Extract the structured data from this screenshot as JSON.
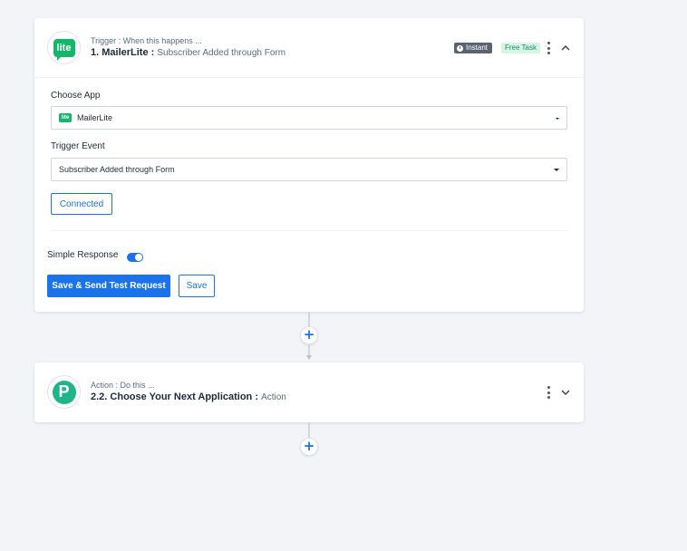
{
  "trigger": {
    "subtitle": "Trigger : When this happens ...",
    "title_strong": "1. MailerLite :",
    "title_light": "Subscriber Added through Form",
    "logo_text": "lite",
    "badge_instant": "Instant",
    "badge_free": "Free Task",
    "choose_app_label": "Choose App",
    "choose_app_value": "MailerLite",
    "choose_app_logo_text": "lite",
    "trigger_event_label": "Trigger Event",
    "trigger_event_value": "Subscriber Added through Form",
    "connected_label": "Connected",
    "simple_response_label": "Simple Response",
    "simple_response_on": true,
    "save_send_label": "Save & Send Test Request",
    "save_label": "Save"
  },
  "action": {
    "subtitle": "Action : Do this ...",
    "title_strong": "2.2. Choose Your Next Application :",
    "title_light": "Action",
    "logo_text": "P"
  },
  "connectors": {
    "add_symbol": "+"
  },
  "colors": {
    "background": "#f2f4f7",
    "accent": "#1a73e8",
    "mailerlite_green": "#12b76a",
    "pabbly_green": "#1fb58a",
    "instant_badge": "#5a6470",
    "free_badge_bg": "#d7f5e6",
    "free_badge_text": "#17915a"
  },
  "icons": {
    "instant": "clock-icon",
    "menu": "kebab-menu-icon",
    "collapse": "chevron-up-icon",
    "expand": "chevron-down-icon",
    "dropdown": "caret-down-icon",
    "add": "plus-icon"
  }
}
